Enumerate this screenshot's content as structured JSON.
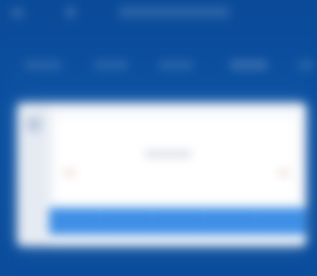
{
  "colors": {
    "background": "#0b4d9a",
    "card": "#f4f6fa",
    "panel": "#ffffff",
    "action_bar": "#3f8fe6"
  },
  "header": {
    "title": ""
  },
  "nav": {
    "items": [
      {
        "label": ""
      },
      {
        "label": ""
      },
      {
        "label": ""
      },
      {
        "label": ""
      },
      {
        "label": ""
      }
    ]
  },
  "card": {
    "center_text": ""
  },
  "action_bar": {
    "buttons": [
      {
        "label": ""
      },
      {
        "label": ""
      },
      {
        "label": ""
      },
      {
        "label": ""
      },
      {
        "label": ""
      }
    ]
  }
}
